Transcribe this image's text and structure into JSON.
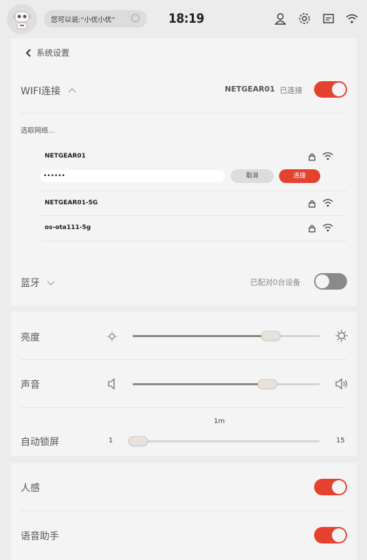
{
  "topbar": {
    "search_placeholder": "您可以说:“小优小优”",
    "time": "18:19"
  },
  "header": {
    "back_label": "系统设置"
  },
  "wifi": {
    "label": "WIFI连接",
    "current_network": "NETGEAR01",
    "status": "已连接",
    "enabled": true,
    "select_label": "选取网络...",
    "networks": [
      {
        "name": "NETGEAR01"
      },
      {
        "name": "NETGEAR01-5G"
      },
      {
        "name": "os-ota111-5g"
      }
    ],
    "password_value": "••••••",
    "cancel_label": "取消",
    "connect_label": "连接"
  },
  "bluetooth": {
    "label": "蓝牙",
    "paired_text": "已配对0台设备",
    "enabled": false
  },
  "brightness": {
    "label": "亮度",
    "level": 0.74
  },
  "volume": {
    "label": "声音",
    "level": 0.72
  },
  "autolock": {
    "label": "自动锁屏",
    "value_label": "1m",
    "min_label": "1",
    "max_label": "15",
    "value": 1
  },
  "presence": {
    "label": "人感",
    "enabled": true
  },
  "voice_assistant": {
    "label": "语音助手",
    "enabled": true
  },
  "colors": {
    "accent": "#e4412f",
    "toggle_off": "#8a8a8a",
    "background": "#ececec",
    "card": "#f4f4f4"
  }
}
